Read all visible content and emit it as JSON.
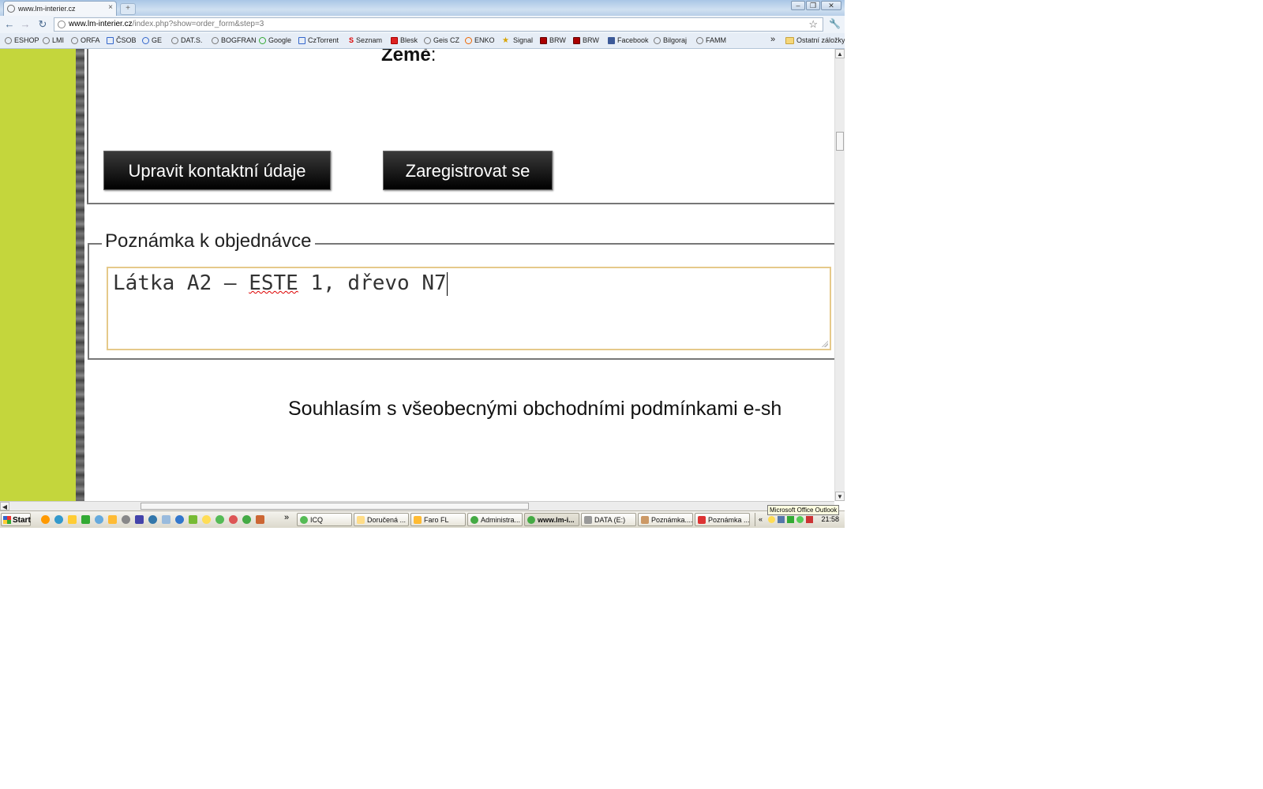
{
  "browser": {
    "tab_title": "www.lm-interier.cz",
    "tab_close": "×",
    "new_tab": "+",
    "url_host": "www.lm-interier.cz",
    "url_path": "/index.php?show=order_form&step=3",
    "bookmarks": [
      "ESHOP",
      "LMI",
      "ORFA",
      "ČSOB",
      "GE",
      "DAT.S.",
      "BOGFRAN",
      "Google",
      "CzTorrent",
      "Seznam",
      "Blesk",
      "Geis CZ",
      "ENKO",
      "Signal",
      "BRW",
      "BRW",
      "Facebook",
      "Bilgoraj",
      "FAMM"
    ],
    "bookmarks_more": "»",
    "other_bookmarks": "Ostatní záložky"
  },
  "page": {
    "country_label": "Země",
    "country_colon": ":",
    "edit_contact_button": "Upravit kontaktní údaje",
    "register_button": "Zaregistrovat se",
    "note_legend": "Poznámka k objednávce",
    "note_value_part1": "Látka A2 – ",
    "note_value_misspelled": "ESTE",
    "note_value_part2": " 1, dřevo N7",
    "terms_text": "Souhlasím s všeobecnými obchodními podmínkami e-sh"
  },
  "taskbar": {
    "start_label": "Start",
    "quicklaunch_more": "»",
    "tasks": [
      "ICQ",
      "Doručená ...",
      "Faro FL",
      "Administra...",
      "www.lm-i...",
      "DATA (E:)",
      "Poznámka....",
      "Poznámka ..."
    ],
    "tray_more": "«",
    "clock": "21:58",
    "tooltip": "Microsoft Office Outlook"
  },
  "colors": {
    "side_green": "#c4d63c",
    "button_black": "#000000",
    "textarea_border": "#e5c98a"
  }
}
